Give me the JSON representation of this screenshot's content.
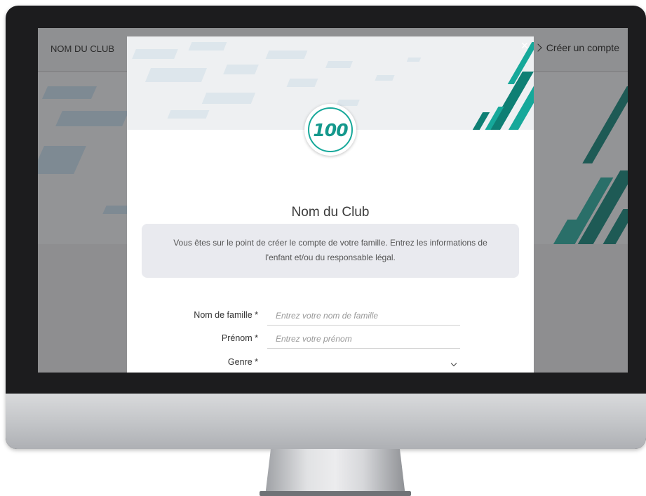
{
  "site": {
    "logo_text": "NOM DU CLUB",
    "signup_link": "Créer un compte"
  },
  "modal": {
    "logo_text": "100",
    "close_label": "×",
    "title": "Nom du Club",
    "info": "Vous êtes sur le point de créer le compte de votre famille. Entrez les informations de l'enfant et/ou du responsable légal.",
    "fields": {
      "last_name": {
        "label": "Nom de famille *",
        "placeholder": "Entrez votre nom de famille",
        "value": ""
      },
      "first_name": {
        "label": "Prénom *",
        "placeholder": "Entrez votre prénom",
        "value": ""
      },
      "gender": {
        "label": "Genre *",
        "value": ""
      }
    }
  },
  "colors": {
    "accent": "#16a89a",
    "accent_dark": "#0e7f74",
    "overlay": "#8e8e90",
    "info_box": "#e9eaef"
  },
  "icons": {
    "signup": "chevron-right-icon",
    "close": "close-icon",
    "select": "chevron-down-icon"
  }
}
